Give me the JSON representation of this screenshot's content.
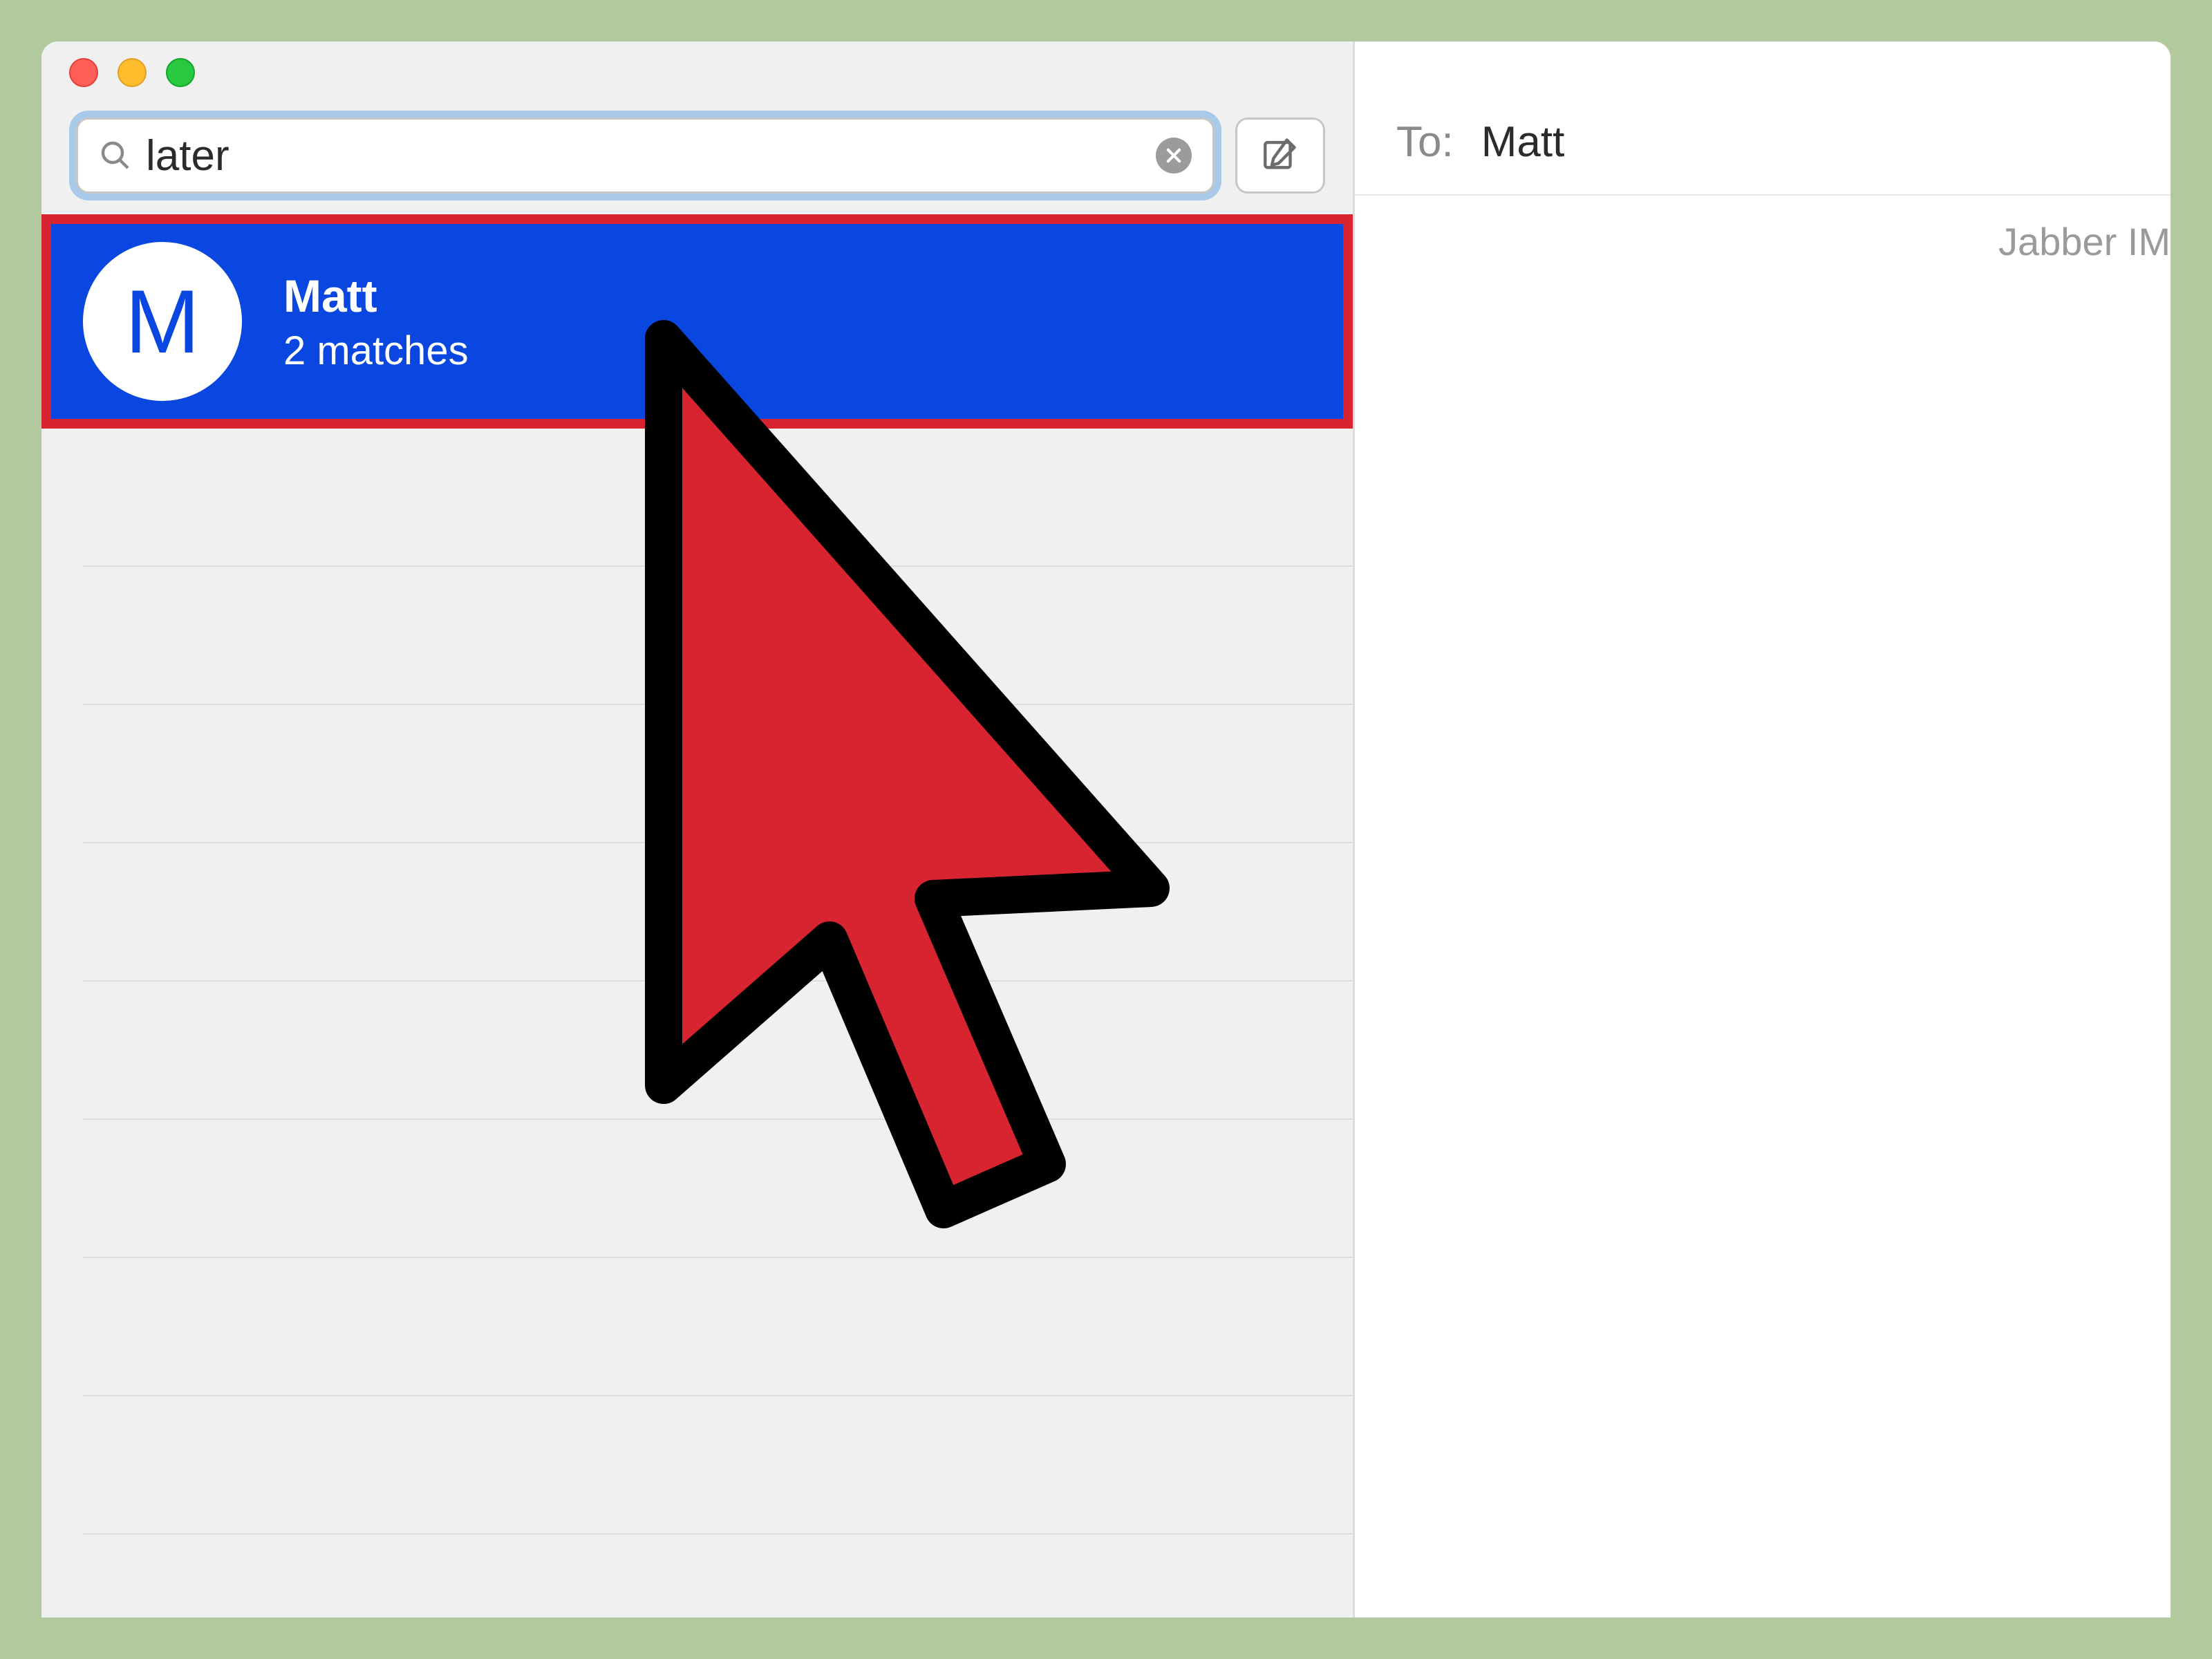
{
  "search": {
    "value": "later",
    "placeholder": ""
  },
  "sidebar": {
    "items": [
      {
        "avatar_initial": "M",
        "name": "Matt",
        "subtitle": "2 matches"
      }
    ]
  },
  "content": {
    "to_label": "To:",
    "to_value": "Matt",
    "service_hint": "Jabber IM"
  },
  "colors": {
    "selection": "#0a47e0",
    "highlight_ring": "#d72430",
    "cursor_fill": "#d72430"
  }
}
